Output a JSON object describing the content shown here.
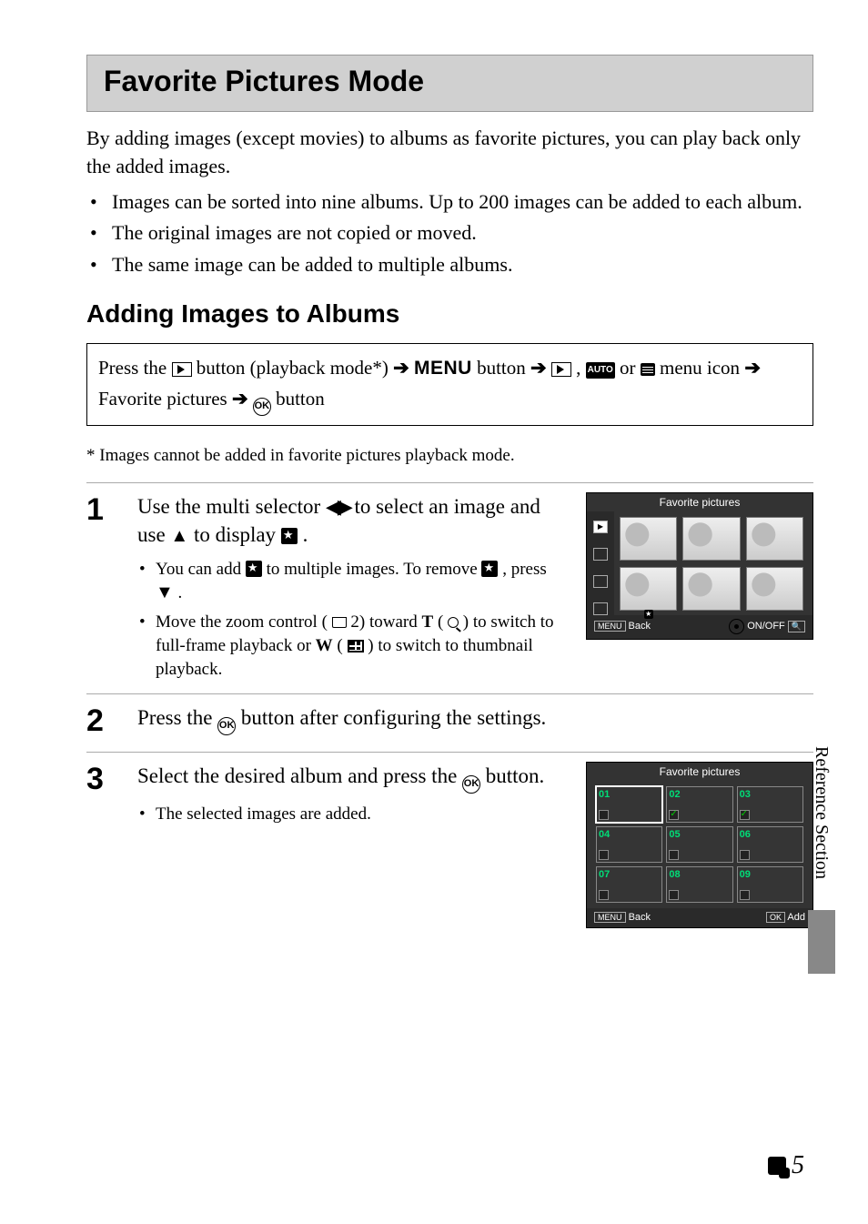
{
  "title": "Favorite Pictures Mode",
  "intro": "By adding images (except movies) to albums as favorite pictures, you can play back only the added images.",
  "top_bullets": [
    "Images can be sorted into nine albums. Up to 200 images can be added to each album.",
    "The original images are not copied or moved.",
    "The same image can be added to multiple albums."
  ],
  "section_heading": "Adding Images to Albums",
  "nav": {
    "t1": "Press the ",
    "t2": " button (playback mode*) ",
    "t3": " button ",
    "t4": " , ",
    "t5": " or ",
    "t6": " menu icon ",
    "t7": " Favorite pictures ",
    "t8": " button",
    "menu_label": "MENU",
    "auto_label": "AUTO",
    "ok_label": "OK"
  },
  "footnote": "*  Images cannot be added in favorite pictures playback mode.",
  "steps": {
    "s1": {
      "num": "1",
      "title_a": "Use the multi selector ",
      "title_b": " to select an image and use ",
      "title_c": " to display ",
      "title_d": ".",
      "sub1_a": "You can add ",
      "sub1_b": " to multiple images. To remove ",
      "sub1_c": ", press ",
      "sub1_d": ".",
      "sub2_a": "Move the zoom control (",
      "sub2_b": "2) toward ",
      "sub2_c": " (",
      "sub2_d": ") to switch to full-frame playback or ",
      "sub2_e": " (",
      "sub2_f": ") to switch to thumbnail playback.",
      "sub2_T": "T",
      "sub2_W": "W"
    },
    "s2": {
      "num": "2",
      "title_a": "Press the ",
      "title_b": " button after configuring the settings."
    },
    "s3": {
      "num": "3",
      "title": "Select the desired album and press the ",
      "title_b": " button.",
      "sub1": "The selected images are added."
    }
  },
  "lcd1": {
    "title": "Favorite pictures",
    "foot_back_label": "MENU",
    "foot_back_text": "Back",
    "foot_onoff": "ON/OFF"
  },
  "lcd2": {
    "title": "Favorite pictures",
    "albums": [
      "01",
      "02",
      "03",
      "04",
      "05",
      "06",
      "07",
      "08",
      "09"
    ],
    "foot_back_label": "MENU",
    "foot_back_text": "Back",
    "foot_ok_label": "OK",
    "foot_ok_text": "Add"
  },
  "sidebar": "Reference Section",
  "page_number": "5"
}
